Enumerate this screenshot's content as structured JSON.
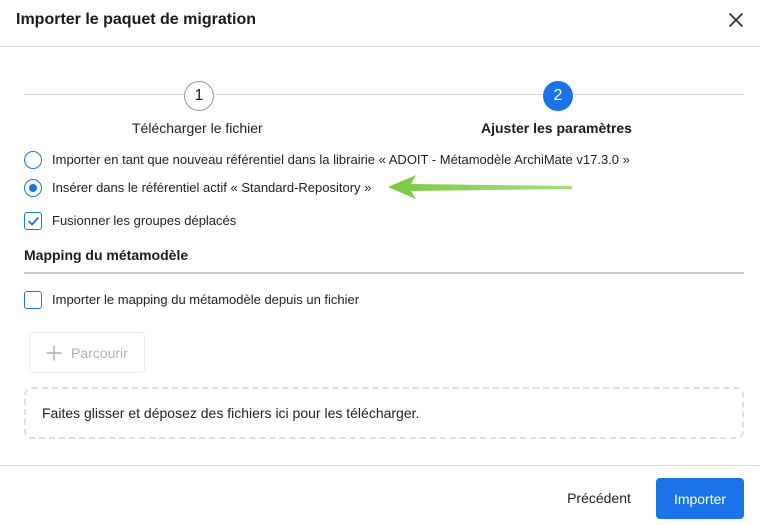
{
  "dialog": {
    "title": "Importer le paquet de migration",
    "close_icon": "close-icon"
  },
  "stepper": {
    "steps": [
      {
        "number": "1",
        "label": "Télécharger le fichier",
        "state": "inactive"
      },
      {
        "number": "2",
        "label": "Ajuster les paramètres",
        "state": "active"
      }
    ]
  },
  "options": {
    "radio_new_repo": {
      "label": "Importer en tant que nouveau référentiel dans la librairie « ADOIT - Métamodèle ArchiMate v17.3.0 »",
      "selected": false
    },
    "radio_insert_active": {
      "label": "Insérer dans le référentiel actif « Standard-Repository »",
      "selected": true
    },
    "checkbox_merge_groups": {
      "label": "Fusionner les groupes déplacés",
      "checked": true
    }
  },
  "mapping": {
    "title": "Mapping du métamodèle",
    "checkbox_import_mapping": {
      "label": "Importer le mapping du métamodèle depuis un fichier",
      "checked": false
    },
    "browse_label": "Parcourir",
    "browse_icon": "plus-icon",
    "dropzone_text": "Faites glisser et déposez des fichiers ici pour les télécharger."
  },
  "footer": {
    "previous_label": "Précédent",
    "import_label": "Importer"
  },
  "annotation": {
    "arrow_icon": "arrow-left-icon",
    "arrow_color": "#7ac943"
  },
  "colors": {
    "accent": "#1a73e8",
    "disabled_text": "#b0b0b0"
  }
}
